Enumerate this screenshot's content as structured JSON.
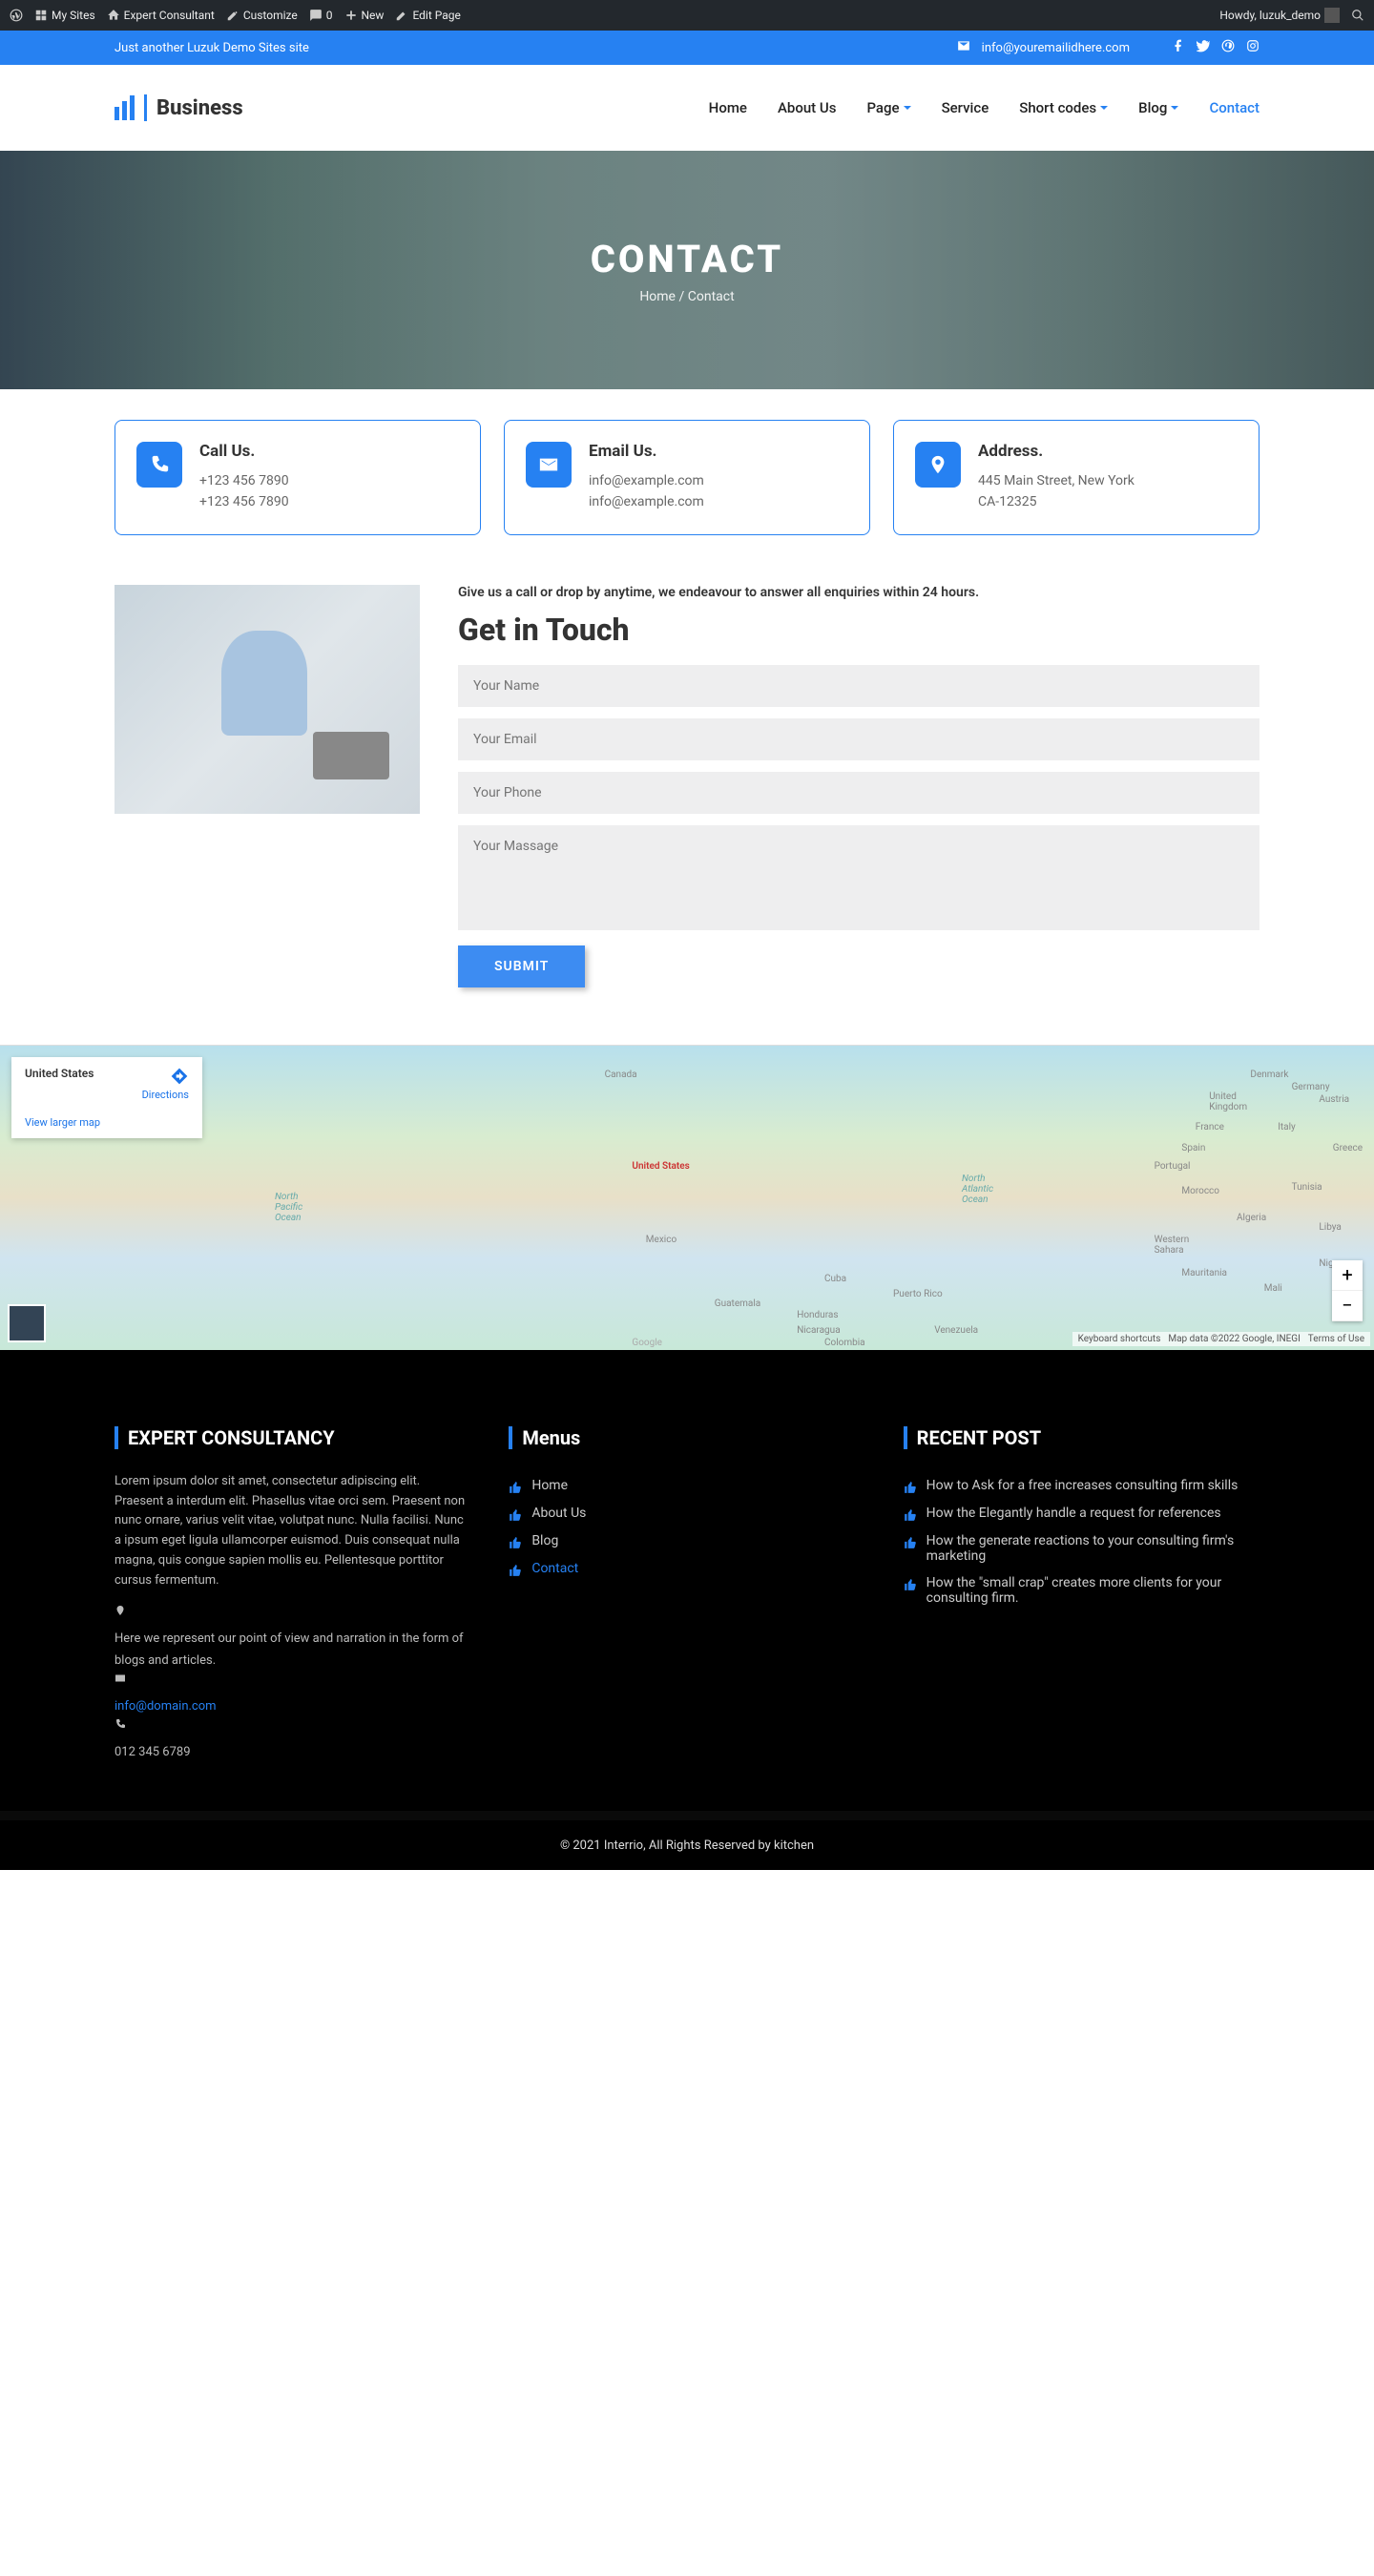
{
  "adminbar": {
    "mysites": "My Sites",
    "expert": "Expert Consultant",
    "customize": "Customize",
    "comments": "0",
    "new": "New",
    "editpage": "Edit Page",
    "howdy": "Howdy, luzuk_demo"
  },
  "topbar": {
    "tagline": "Just another Luzuk Demo Sites site",
    "email": "info@youremailidhere.com"
  },
  "logo": "Business",
  "nav": {
    "home": "Home",
    "about": "About Us",
    "page": "Page",
    "service": "Service",
    "short": "Short codes",
    "blog": "Blog",
    "contact": "Contact"
  },
  "hero": {
    "title": "CONTACT",
    "home": "Home",
    "sep": "/",
    "current": "Contact"
  },
  "cards": {
    "call": {
      "title": "Call Us.",
      "line1": "+123 456 7890",
      "line2": "+123 456 7890"
    },
    "email": {
      "title": "Email Us.",
      "line1": "info@example.com",
      "line2": "info@example.com"
    },
    "address": {
      "title": "Address.",
      "line1": "445 Main Street, New York",
      "line2": "CA-12325"
    }
  },
  "form": {
    "intro": "Give us a call or drop by anytime, we endeavour to answer all enquiries within 24 hours.",
    "title": "Get in Touch",
    "name": "Your Name",
    "email": "Your Email",
    "phone": "Your Phone",
    "message": "Your Massage",
    "submit": "SUBMIT"
  },
  "map": {
    "country": "United States",
    "directions": "Directions",
    "larger": "View larger map",
    "kb": "Keyboard shortcuts",
    "data": "Map data ©2022 Google, INEGI",
    "terms": "Terms of Use"
  },
  "footer": {
    "col1": {
      "title": "EXPERT CONSULTANCY",
      "text": "Lorem ipsum dolor sit amet, consectetur adipiscing elit. Praesent a interdum elit. Phasellus vitae orci sem. Praesent non nunc ornare, varius velit vitae, volutpat nunc. Nulla facilisi. Nunc a ipsum eget ligula ullamcorper euismod. Duis consequat nulla magna, quis congue sapien mollis eu. Pellentesque porttitor cursus fermentum.",
      "place": "Here we represent our point of view and narration in the form of blogs and articles.",
      "email": "info@domain.com",
      "phone": "012 345 6789"
    },
    "col2": {
      "title": "Menus",
      "items": [
        "Home",
        "About Us",
        "Blog",
        "Contact"
      ]
    },
    "col3": {
      "title": "RECENT POST",
      "items": [
        "How to Ask for a free increases consulting firm skills",
        "How the Elegantly handle a request for references",
        "How the generate reactions to your consulting firm's marketing",
        "How the \"small crap\" creates more clients for your consulting firm."
      ]
    }
  },
  "copyright": "© 2021 Interrio, All Rights Reserved by kitchen"
}
